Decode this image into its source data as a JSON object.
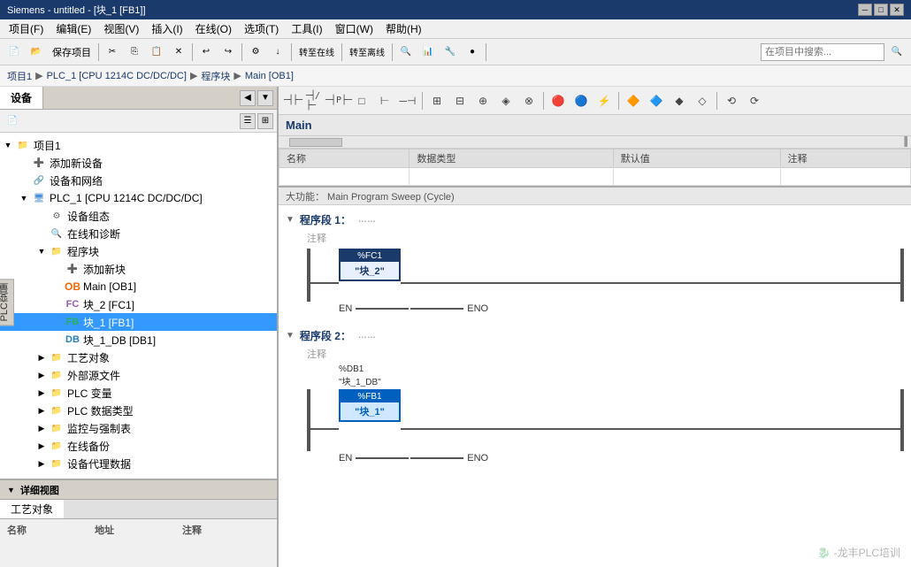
{
  "titlebar": {
    "text": "Siemens - untitled - [块_1 [FB1]]",
    "controls": [
      "─",
      "□",
      "✕"
    ]
  },
  "menubar": {
    "items": [
      "项目(F)",
      "编辑(E)",
      "视图(V)",
      "插入(I)",
      "在线(O)",
      "选项(T)",
      "工具(I)",
      "窗口(W)",
      "帮助(H)"
    ]
  },
  "toolbar": {
    "save_label": "保存项目",
    "search_placeholder": "在项目中搜索..."
  },
  "breadcrumb": {
    "items": [
      "项目1",
      "PLC_1 [CPU 1214C DC/DC/DC]",
      "程序块",
      "Main [OB1]"
    ]
  },
  "left_panel": {
    "tab": "设备",
    "vertical_label": "PLC 变量",
    "tree": [
      {
        "label": "项目1",
        "level": 0,
        "type": "folder",
        "expanded": true
      },
      {
        "label": "添加新设备",
        "level": 1,
        "type": "add"
      },
      {
        "label": "设备和网络",
        "level": 1,
        "type": "device"
      },
      {
        "label": "PLC_1 [CPU 1214C DC/DC/DC]",
        "level": 1,
        "type": "cpu",
        "expanded": true
      },
      {
        "label": "设备组态",
        "level": 2,
        "type": "config"
      },
      {
        "label": "在线和诊断",
        "level": 2,
        "type": "diag"
      },
      {
        "label": "程序块",
        "level": 2,
        "type": "folder",
        "expanded": true
      },
      {
        "label": "添加新块",
        "level": 3,
        "type": "add"
      },
      {
        "label": "Main [OB1]",
        "level": 3,
        "type": "ob"
      },
      {
        "label": "块_2 [FC1]",
        "level": 3,
        "type": "fc"
      },
      {
        "label": "块_1 [FB1]",
        "level": 3,
        "type": "fb",
        "selected": true
      },
      {
        "label": "块_1_DB [DB1]",
        "level": 3,
        "type": "db"
      },
      {
        "label": "工艺对象",
        "level": 2,
        "type": "folder"
      },
      {
        "label": "外部源文件",
        "level": 2,
        "type": "folder"
      },
      {
        "label": "PLC 变量",
        "level": 2,
        "type": "folder"
      },
      {
        "label": "PLC 数据类型",
        "level": 2,
        "type": "folder"
      },
      {
        "label": "监控与强制表",
        "level": 2,
        "type": "folder"
      },
      {
        "label": "在线备份",
        "level": 2,
        "type": "folder"
      },
      {
        "label": "设备代理数据",
        "level": 2,
        "type": "folder"
      }
    ]
  },
  "bottom_panel": {
    "title": "详细视图",
    "tab": "工艺对象",
    "columns": [
      "名称",
      "地址",
      "注释"
    ]
  },
  "editor": {
    "block_name": "Main",
    "prog_info": "大功能：    Main Program Sweep (Cycle)",
    "var_table": {
      "headers": [
        "名称",
        "数据类型",
        "默认值",
        "注释"
      ],
      "rows": []
    },
    "toolbar_icons": [
      "contact-no",
      "contact-nc",
      "coil",
      "box",
      "branch-open",
      "branch-close"
    ],
    "networks": [
      {
        "id": "程序段 1：",
        "comment": "注释",
        "blocks": [
          {
            "type": "FC",
            "ref": "%FC1",
            "name": "块_2",
            "has_en_eno": true
          }
        ]
      },
      {
        "id": "程序段 2：",
        "comment": "注释",
        "db_ref": "%DB1",
        "db_name": "块_1_DB",
        "blocks": [
          {
            "type": "FB",
            "ref": "%FB1",
            "name": "块_1",
            "has_en_eno": true
          }
        ]
      }
    ]
  },
  "watermark": "龙丰PLC培训"
}
